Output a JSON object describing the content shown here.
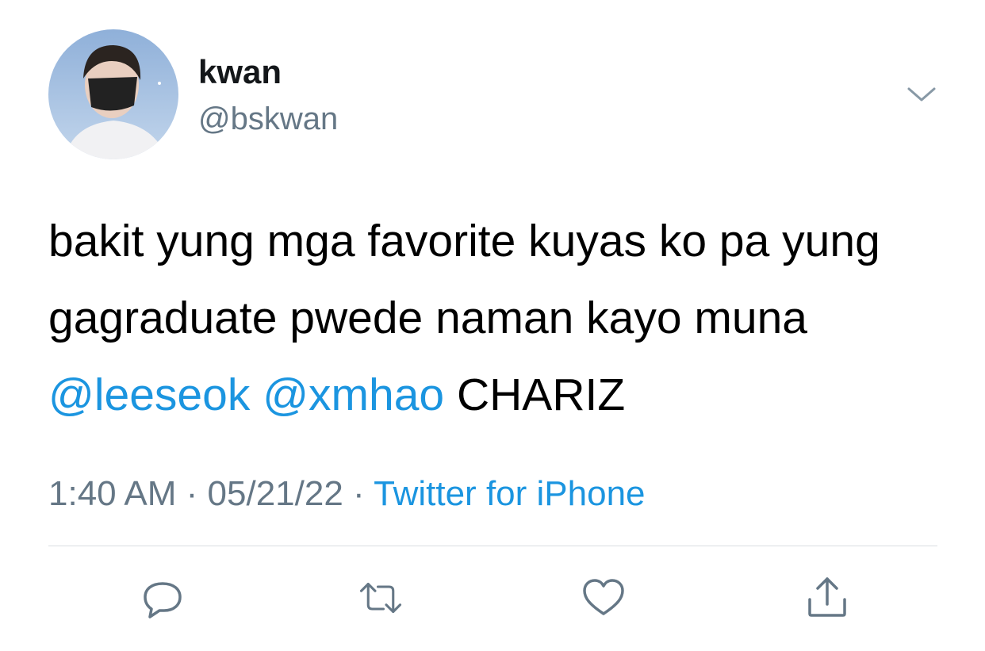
{
  "user": {
    "display_name": "kwan",
    "handle": "@bskwan"
  },
  "tweet": {
    "text_part1": "bakit yung mga favorite kuyas ko pa yung gagraduate pwede naman kayo muna ",
    "mention1": "@leeseok",
    "space": " ",
    "mention2": "@xmhao",
    "text_part2": " CHARIZ"
  },
  "meta": {
    "time": "1:40 AM",
    "separator": " · ",
    "date": "05/21/22",
    "source": "Twitter for iPhone"
  },
  "icons": {
    "menu": "chevron-down-icon",
    "reply": "reply-icon",
    "retweet": "retweet-icon",
    "like": "heart-icon",
    "share": "share-icon"
  },
  "colors": {
    "mention": "#1b95e0",
    "secondary_text": "#657786",
    "primary_text": "#14171a"
  }
}
